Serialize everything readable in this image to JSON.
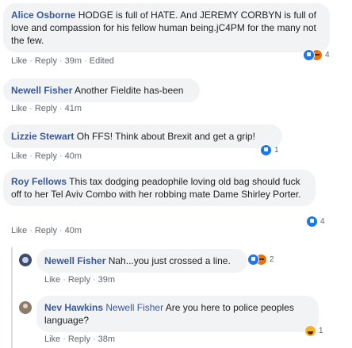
{
  "comments": [
    {
      "author": "Alice Osborne",
      "text": "HODGE is full of HATE. And JEREMY CORBYN is full of love and compassion for his fellow human being.jC4PM for the many not the few.",
      "like_label": "Like",
      "reply_label": "Reply",
      "time": "39m",
      "edited_label": "Edited",
      "reaction_count": "4"
    },
    {
      "author": "Newell Fisher",
      "text": "Another Fieldite has-been",
      "like_label": "Like",
      "reply_label": "Reply",
      "time": "41m"
    },
    {
      "author": "Lizzie Stewart",
      "text": "Oh FFS! Think about Brexit and get a grip!",
      "like_label": "Like",
      "reply_label": "Reply",
      "time": "40m",
      "reaction_count": "1"
    },
    {
      "author": "Roy Fellows",
      "text": "This tax dodging peadophile loving old bag should fuck off to her Tel Aviv Combo with her robbing mate Dame Shirley Porter.",
      "like_label": "Like",
      "reply_label": "Reply",
      "time": "40m",
      "reaction_count": "4"
    }
  ],
  "replies": [
    {
      "author": "Newell Fisher",
      "text": "Nah...you just crossed a line.",
      "like_label": "Like",
      "reply_label": "Reply",
      "time": "39m",
      "reaction_count": "2"
    },
    {
      "author": "Nev Hawkins",
      "mention": "Newell Fisher",
      "text": "Are you here to police peoples language?",
      "like_label": "Like",
      "reply_label": "Reply",
      "time": "38m",
      "reaction_count": "1"
    }
  ],
  "separator": "·",
  "colors": {
    "link": "#385898",
    "bubble": "#f2f3f5",
    "like": "#1877f2",
    "angry": "#e9710f",
    "haha": "#f7b125"
  }
}
